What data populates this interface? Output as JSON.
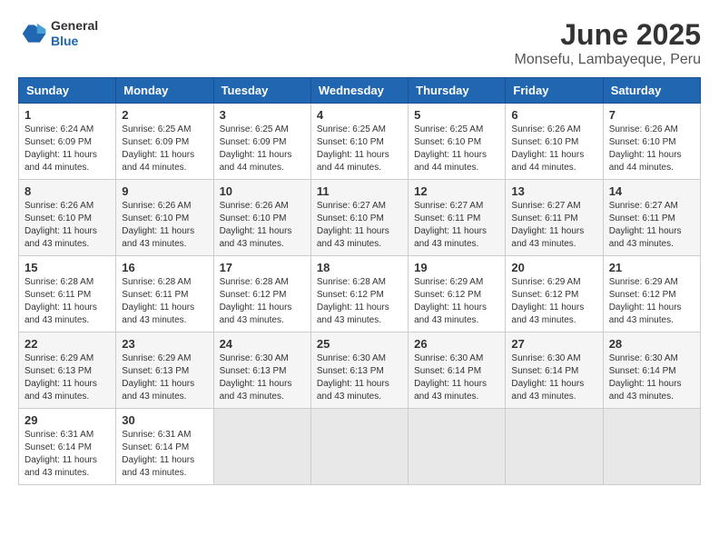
{
  "header": {
    "logo_general": "General",
    "logo_blue": "Blue",
    "main_title": "June 2025",
    "subtitle": "Monsefu, Lambayeque, Peru"
  },
  "calendar": {
    "days_of_week": [
      "Sunday",
      "Monday",
      "Tuesday",
      "Wednesday",
      "Thursday",
      "Friday",
      "Saturday"
    ],
    "weeks": [
      [
        {
          "num": "1",
          "sunrise": "6:24 AM",
          "sunset": "6:09 PM",
          "daylight": "11 hours and 44 minutes."
        },
        {
          "num": "2",
          "sunrise": "6:25 AM",
          "sunset": "6:09 PM",
          "daylight": "11 hours and 44 minutes."
        },
        {
          "num": "3",
          "sunrise": "6:25 AM",
          "sunset": "6:09 PM",
          "daylight": "11 hours and 44 minutes."
        },
        {
          "num": "4",
          "sunrise": "6:25 AM",
          "sunset": "6:10 PM",
          "daylight": "11 hours and 44 minutes."
        },
        {
          "num": "5",
          "sunrise": "6:25 AM",
          "sunset": "6:10 PM",
          "daylight": "11 hours and 44 minutes."
        },
        {
          "num": "6",
          "sunrise": "6:26 AM",
          "sunset": "6:10 PM",
          "daylight": "11 hours and 44 minutes."
        },
        {
          "num": "7",
          "sunrise": "6:26 AM",
          "sunset": "6:10 PM",
          "daylight": "11 hours and 44 minutes."
        }
      ],
      [
        {
          "num": "8",
          "sunrise": "6:26 AM",
          "sunset": "6:10 PM",
          "daylight": "11 hours and 43 minutes."
        },
        {
          "num": "9",
          "sunrise": "6:26 AM",
          "sunset": "6:10 PM",
          "daylight": "11 hours and 43 minutes."
        },
        {
          "num": "10",
          "sunrise": "6:26 AM",
          "sunset": "6:10 PM",
          "daylight": "11 hours and 43 minutes."
        },
        {
          "num": "11",
          "sunrise": "6:27 AM",
          "sunset": "6:10 PM",
          "daylight": "11 hours and 43 minutes."
        },
        {
          "num": "12",
          "sunrise": "6:27 AM",
          "sunset": "6:11 PM",
          "daylight": "11 hours and 43 minutes."
        },
        {
          "num": "13",
          "sunrise": "6:27 AM",
          "sunset": "6:11 PM",
          "daylight": "11 hours and 43 minutes."
        },
        {
          "num": "14",
          "sunrise": "6:27 AM",
          "sunset": "6:11 PM",
          "daylight": "11 hours and 43 minutes."
        }
      ],
      [
        {
          "num": "15",
          "sunrise": "6:28 AM",
          "sunset": "6:11 PM",
          "daylight": "11 hours and 43 minutes."
        },
        {
          "num": "16",
          "sunrise": "6:28 AM",
          "sunset": "6:11 PM",
          "daylight": "11 hours and 43 minutes."
        },
        {
          "num": "17",
          "sunrise": "6:28 AM",
          "sunset": "6:12 PM",
          "daylight": "11 hours and 43 minutes."
        },
        {
          "num": "18",
          "sunrise": "6:28 AM",
          "sunset": "6:12 PM",
          "daylight": "11 hours and 43 minutes."
        },
        {
          "num": "19",
          "sunrise": "6:29 AM",
          "sunset": "6:12 PM",
          "daylight": "11 hours and 43 minutes."
        },
        {
          "num": "20",
          "sunrise": "6:29 AM",
          "sunset": "6:12 PM",
          "daylight": "11 hours and 43 minutes."
        },
        {
          "num": "21",
          "sunrise": "6:29 AM",
          "sunset": "6:12 PM",
          "daylight": "11 hours and 43 minutes."
        }
      ],
      [
        {
          "num": "22",
          "sunrise": "6:29 AM",
          "sunset": "6:13 PM",
          "daylight": "11 hours and 43 minutes."
        },
        {
          "num": "23",
          "sunrise": "6:29 AM",
          "sunset": "6:13 PM",
          "daylight": "11 hours and 43 minutes."
        },
        {
          "num": "24",
          "sunrise": "6:30 AM",
          "sunset": "6:13 PM",
          "daylight": "11 hours and 43 minutes."
        },
        {
          "num": "25",
          "sunrise": "6:30 AM",
          "sunset": "6:13 PM",
          "daylight": "11 hours and 43 minutes."
        },
        {
          "num": "26",
          "sunrise": "6:30 AM",
          "sunset": "6:14 PM",
          "daylight": "11 hours and 43 minutes."
        },
        {
          "num": "27",
          "sunrise": "6:30 AM",
          "sunset": "6:14 PM",
          "daylight": "11 hours and 43 minutes."
        },
        {
          "num": "28",
          "sunrise": "6:30 AM",
          "sunset": "6:14 PM",
          "daylight": "11 hours and 43 minutes."
        }
      ],
      [
        {
          "num": "29",
          "sunrise": "6:31 AM",
          "sunset": "6:14 PM",
          "daylight": "11 hours and 43 minutes."
        },
        {
          "num": "30",
          "sunrise": "6:31 AM",
          "sunset": "6:14 PM",
          "daylight": "11 hours and 43 minutes."
        },
        null,
        null,
        null,
        null,
        null
      ]
    ]
  }
}
